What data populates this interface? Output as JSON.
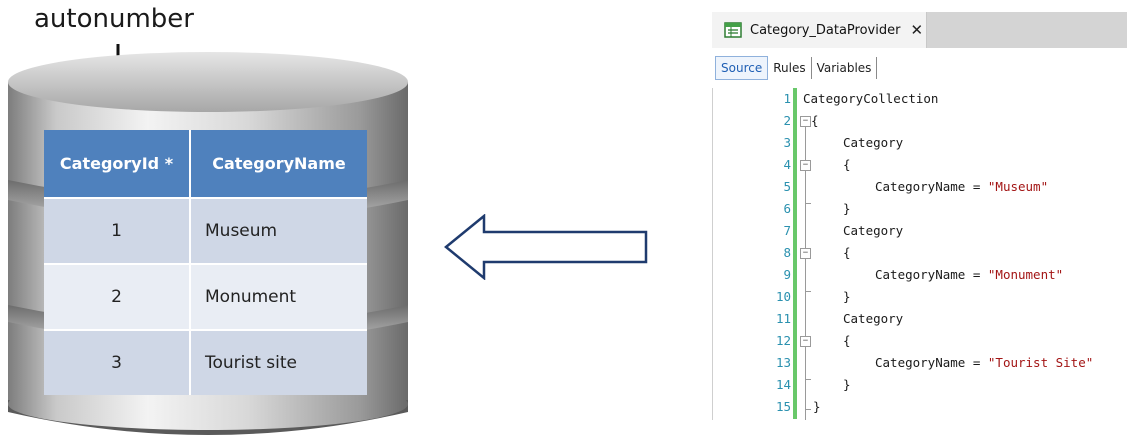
{
  "annotation": {
    "label": "autonumber"
  },
  "table": {
    "headers": [
      "CategoryId *",
      "CategoryName"
    ],
    "rows": [
      [
        "1",
        "Museum"
      ],
      [
        "2",
        "Monument"
      ],
      [
        "3",
        "Tourist site"
      ]
    ]
  },
  "editor": {
    "tab_title": "Category_DataProvider",
    "close_glyph": "✕",
    "subtabs": [
      "Source",
      "Rules",
      "Variables"
    ],
    "active_subtab": "Source",
    "line_numbers": [
      "1",
      "2",
      "3",
      "4",
      "5",
      "6",
      "7",
      "8",
      "9",
      "10",
      "11",
      "12",
      "13",
      "14",
      "15"
    ],
    "code": {
      "collection": "CategoryCollection",
      "open_brace": "{",
      "close_brace": "}",
      "item": "Category",
      "assign_prefix": "CategoryName = ",
      "values": [
        "\"Museum\"",
        "\"Monument\"",
        "\"Tourist Site\""
      ]
    }
  },
  "colors": {
    "header_blue": "#4f81bd",
    "row_odd": "#cfd7e6",
    "row_even": "#e9edf4",
    "arrow_stroke": "#1f3b6e",
    "string_red": "#a31515",
    "line_number": "#2b91af",
    "gutter_green": "#69c86a"
  }
}
